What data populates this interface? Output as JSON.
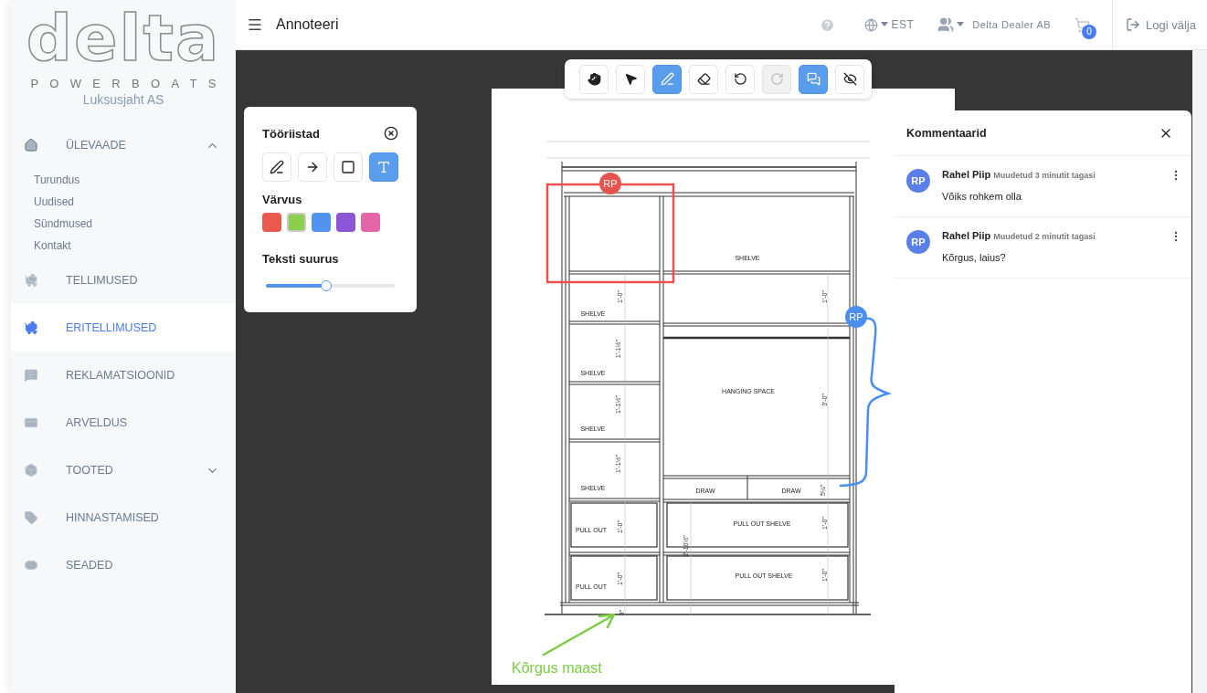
{
  "sidebar": {
    "logo": {
      "wordmark": "delta",
      "tagline": "POWERBOATS"
    },
    "company": "Luksusjaht AS",
    "items": [
      {
        "kind": "group",
        "label": "ÜLEVAADE",
        "expanded": true,
        "selected": false,
        "children": [
          {
            "label": "Turundus"
          },
          {
            "label": "Uudised"
          },
          {
            "label": "Sündmused"
          },
          {
            "label": "Kontakt"
          }
        ]
      },
      {
        "kind": "link",
        "label": "TELLIMUSED",
        "selected": false
      },
      {
        "kind": "link",
        "label": "ERITELLIMUSED",
        "selected": true
      },
      {
        "kind": "link",
        "label": "REKLAMATSIOONID",
        "selected": false
      },
      {
        "kind": "link",
        "label": "ARVELDUS",
        "selected": false
      },
      {
        "kind": "group",
        "label": "TOOTED",
        "expanded": false,
        "selected": false
      },
      {
        "kind": "link",
        "label": "HINNASTAMISED",
        "selected": false
      },
      {
        "kind": "link",
        "label": "SEADED",
        "selected": false
      }
    ]
  },
  "topbar": {
    "title": "Annoteeri",
    "language": "EST",
    "account": "Delta Dealer AB",
    "cart_count": "0",
    "logout": "Logi välja"
  },
  "toolbar": {
    "tools": [
      {
        "kind": "hand",
        "active": false,
        "disabled": false
      },
      {
        "kind": "pointer",
        "active": false,
        "disabled": false
      },
      {
        "kind": "pen",
        "active": true,
        "disabled": false
      },
      {
        "kind": "eraser",
        "active": false,
        "disabled": false
      },
      {
        "kind": "undo",
        "active": false,
        "disabled": false
      },
      {
        "kind": "redo",
        "active": false,
        "disabled": true
      },
      {
        "kind": "comments",
        "active": true,
        "disabled": false
      },
      {
        "kind": "hide",
        "active": false,
        "disabled": false
      }
    ]
  },
  "tools_panel": {
    "title": "Tööriistad",
    "tools": [
      {
        "kind": "pen",
        "selected": false
      },
      {
        "kind": "arrow",
        "selected": false
      },
      {
        "kind": "rectangle",
        "selected": false
      },
      {
        "kind": "text",
        "selected": true
      }
    ],
    "color_label": "Värvus",
    "colors": [
      {
        "color": "#eb5a4f",
        "selected": false
      },
      {
        "color": "#8ccf4d",
        "selected": true
      },
      {
        "color": "#4f94f0",
        "selected": false
      },
      {
        "color": "#8a56d6",
        "selected": false
      },
      {
        "color": "#e565a9",
        "selected": false
      }
    ],
    "size_label": "Teksti suurus",
    "size": {
      "level": 0.47
    }
  },
  "document": {
    "labels": [
      {
        "kind": "label",
        "text": "SHELVE"
      },
      {
        "kind": "label",
        "text": "SHELVE"
      },
      {
        "kind": "label",
        "text": "SHELVE"
      },
      {
        "kind": "label",
        "text": "SHELVE"
      },
      {
        "kind": "label",
        "text": "SHELVE"
      },
      {
        "kind": "label",
        "text": "HANGING SPACE"
      },
      {
        "kind": "label",
        "text": "DRAW"
      },
      {
        "kind": "label",
        "text": "DRAW"
      },
      {
        "kind": "label",
        "text": "PULL OUT"
      },
      {
        "kind": "label",
        "text": "PULL OUT"
      },
      {
        "kind": "label",
        "text": "PULL OUT SHELVE"
      },
      {
        "kind": "label",
        "text": "PULL OUT SHELVE"
      },
      {
        "kind": "dimension",
        "text": "1'-0\""
      },
      {
        "kind": "dimension",
        "text": "1'-0\""
      },
      {
        "kind": "dimension",
        "text": "1'-1½\""
      },
      {
        "kind": "dimension",
        "text": "1'-1½\""
      },
      {
        "kind": "dimension",
        "text": "1'-1½\""
      },
      {
        "kind": "dimension",
        "text": "3'-0\""
      },
      {
        "kind": "dimension",
        "text": "5¼\""
      },
      {
        "kind": "dimension",
        "text": "1'-0\""
      },
      {
        "kind": "dimension",
        "text": "1'-0\""
      },
      {
        "kind": "dimension",
        "text": "1'-0\""
      },
      {
        "kind": "dimension",
        "text": "1'-0\""
      },
      {
        "kind": "dimension",
        "text": "2'-10½\""
      },
      {
        "kind": "dimension",
        "text": "3\""
      }
    ]
  },
  "annotations": [
    {
      "kind": "rectangle",
      "color": "#e8534f",
      "initials": "RP"
    },
    {
      "kind": "freehand",
      "color": "#4a8ef0",
      "initials": "RP"
    },
    {
      "kind": "arrow",
      "color": "#7ccb45",
      "label": "Kõrgus maast"
    }
  ],
  "comments": {
    "title": "Kommentaarid",
    "items": [
      {
        "initials": "RP",
        "author": "Rahel Piip",
        "meta": "Muudetud 3 minutit tagasi",
        "text": "Võiks rohkem olla"
      },
      {
        "initials": "RP",
        "author": "Rahel Piip",
        "meta": "Muudetud 2 minutit tagasi",
        "text": "Kõrgus, laius?"
      }
    ]
  }
}
